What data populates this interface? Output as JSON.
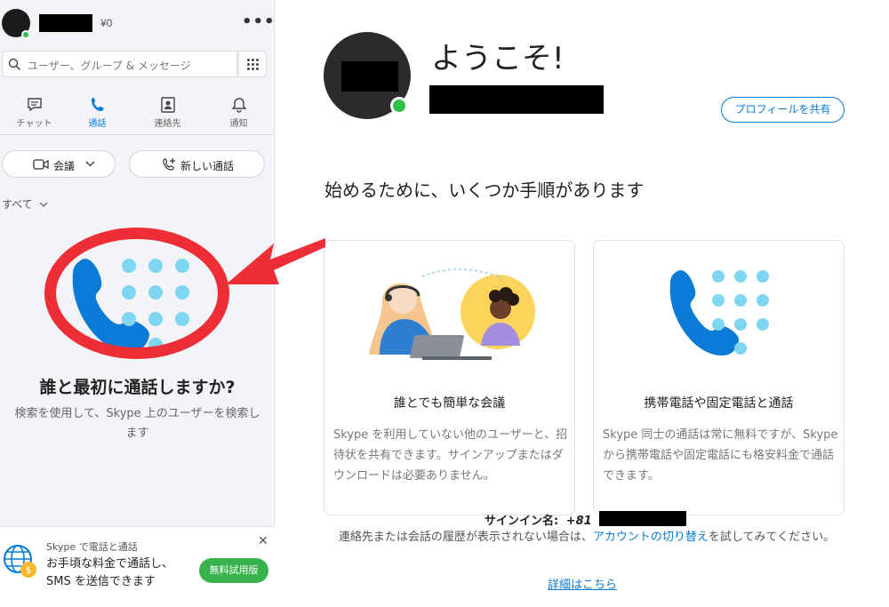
{
  "sidebar": {
    "credit": "¥0",
    "more_label": "•••",
    "search_placeholder": "ユーザー、グループ & メッセージ",
    "nav": [
      {
        "label": "チャット",
        "icon": "chat-icon"
      },
      {
        "label": "通話",
        "icon": "phone-icon",
        "active": true
      },
      {
        "label": "連絡先",
        "icon": "contacts-icon"
      },
      {
        "label": "通知",
        "icon": "bell-icon"
      }
    ],
    "meeting_label": "会議",
    "new_call_label": "新しい通話",
    "filter_label": "すべて",
    "empty_title": "誰と最初に通話しますか?",
    "empty_subtitle": "検索を使用して、Skype 上のユーザーを検索します",
    "promo": {
      "small": "Skype で電話と通話",
      "big": "お手頃な料金で通話し、SMS を送信できます",
      "button": "無料試用版",
      "close": "✕"
    }
  },
  "main": {
    "welcome": "ようこそ!",
    "share_profile": "プロフィールを共有",
    "steps_heading": "始めるために、いくつか手順があります",
    "cards": [
      {
        "title": "誰とでも簡単な会議",
        "desc": "Skype を利用していない他のユーザーと、招待状を共有できます。サインアップまたはダウンロードは必要ありません。"
      },
      {
        "title": "携帯電話や固定電話と通話",
        "desc": "Skype 同士の通話は常に無料ですが、Skype から携帯電話や固定電話にも格安料金で通話できます。"
      }
    ],
    "signin_label": "サインイン名:",
    "signin_value": "+81",
    "footer_before": "連絡先または会話の履歴が表示されない場合は、",
    "footer_link": "アカウントの切り替え",
    "footer_after": "を試してみてください。",
    "details_link": "詳細はこちら"
  },
  "colors": {
    "accent": "#0a7bd6",
    "presence": "#2fc24a",
    "highlight": "#ee2e36",
    "trial": "#37b24d",
    "dialpad_dots": "#7fd6f0"
  }
}
